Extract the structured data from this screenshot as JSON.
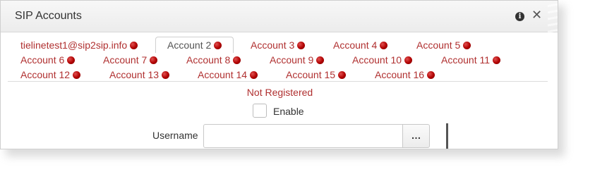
{
  "dialog": {
    "title": "SIP Accounts",
    "info_icon": "info-icon",
    "close_icon": "close-icon"
  },
  "tabs": [
    {
      "label": "tielinetest1@sip2sip.info",
      "status_color": "#b00000",
      "active": false
    },
    {
      "label": "Account 2",
      "status_color": "#b00000",
      "active": true
    },
    {
      "label": "Account 3",
      "status_color": "#b00000",
      "active": false
    },
    {
      "label": "Account 4",
      "status_color": "#b00000",
      "active": false
    },
    {
      "label": "Account 5",
      "status_color": "#b00000",
      "active": false
    },
    {
      "label": "Account 6",
      "status_color": "#b00000",
      "active": false
    },
    {
      "label": "Account 7",
      "status_color": "#b00000",
      "active": false
    },
    {
      "label": "Account 8",
      "status_color": "#b00000",
      "active": false
    },
    {
      "label": "Account 9",
      "status_color": "#b00000",
      "active": false
    },
    {
      "label": "Account 10",
      "status_color": "#b00000",
      "active": false
    },
    {
      "label": "Account 11",
      "status_color": "#b00000",
      "active": false
    },
    {
      "label": "Account 12",
      "status_color": "#b00000",
      "active": false
    },
    {
      "label": "Account 13",
      "status_color": "#b00000",
      "active": false
    },
    {
      "label": "Account 14",
      "status_color": "#b00000",
      "active": false
    },
    {
      "label": "Account 15",
      "status_color": "#b00000",
      "active": false
    },
    {
      "label": "Account 16",
      "status_color": "#b00000",
      "active": false
    }
  ],
  "registration": {
    "status": "Not Registered",
    "status_color": "#b03030"
  },
  "form": {
    "enable_label": "Enable",
    "enable_checked": false,
    "username_label": "Username",
    "username_value": "",
    "more_button_label": "…"
  }
}
